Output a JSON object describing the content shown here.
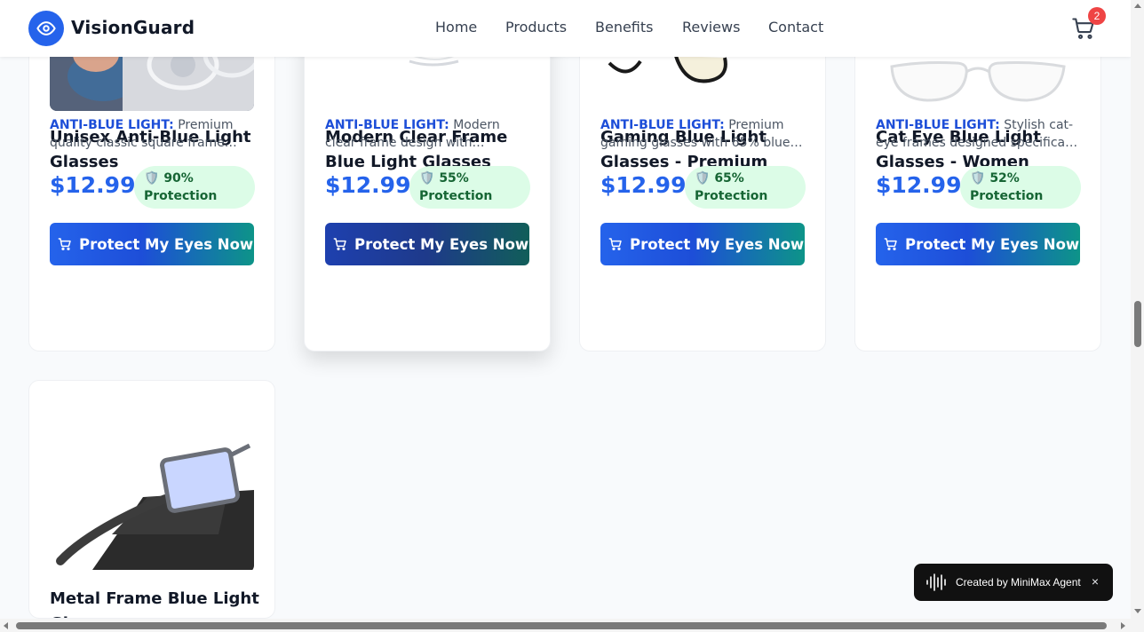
{
  "header": {
    "brand": "VisionGuard",
    "nav": [
      "Home",
      "Products",
      "Benefits",
      "Reviews",
      "Contact"
    ],
    "cart_count": "2"
  },
  "colors": {
    "primary": "#2563eb",
    "badge_bg": "#dcfce7",
    "badge_text": "#166534",
    "cart_badge": "#ef4444"
  },
  "products": [
    {
      "title": "Unisex Anti-Blue Light Glasses",
      "highlight": "ANTI-BLUE LIGHT:",
      "desc": " Premium quality classic square frame…",
      "price": "$12.99",
      "protection": "90% Protection",
      "button": "Protect My Eyes Now"
    },
    {
      "title": "Modern Clear Frame Blue Light Glasses",
      "highlight": "ANTI-BLUE LIGHT:",
      "desc": " Modern clear frame design with…",
      "price": "$12.99",
      "protection": "55% Protection",
      "button": "Protect My Eyes Now"
    },
    {
      "title": "Gaming Blue Light Glasses - Premium",
      "highlight": "ANTI-BLUE LIGHT:",
      "desc": " Premium gaming glasses with 65% blue…",
      "price": "$12.99",
      "protection": "65% Protection",
      "button": "Protect My Eyes Now"
    },
    {
      "title": "Cat Eye Blue Light Glasses - Women",
      "highlight": "ANTI-BLUE LIGHT:",
      "desc": " Stylish cat-eye frames designed specifica…",
      "price": "$12.99",
      "protection": "52% Protection",
      "button": "Protect My Eyes Now"
    },
    {
      "title": "Metal Frame Blue Light Gl…"
    }
  ],
  "toast": {
    "text": "Created by MiniMax Agent",
    "close": "×"
  }
}
